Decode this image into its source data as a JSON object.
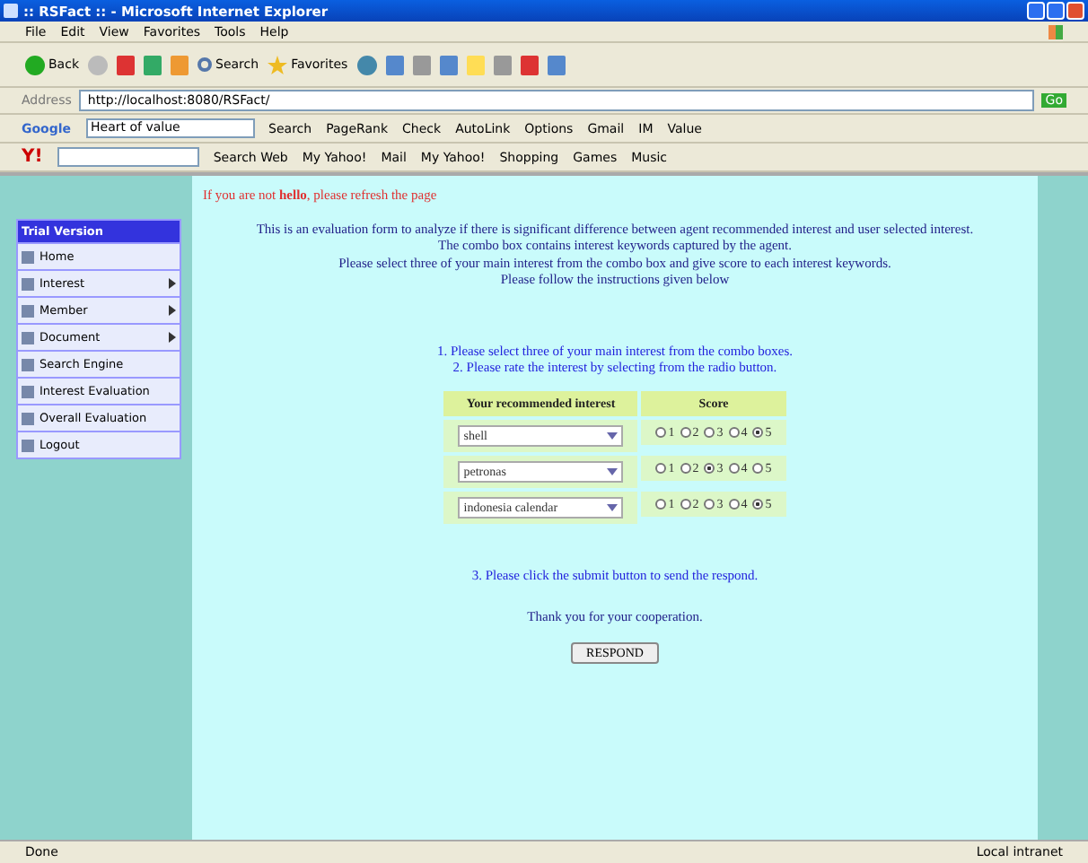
{
  "window": {
    "title": ":: RSFact :: - Microsoft Internet Explorer"
  },
  "menu": [
    "File",
    "Edit",
    "View",
    "Favorites",
    "Tools",
    "Help"
  ],
  "toolbar": {
    "back": "Back",
    "search": "Search",
    "favorites": "Favorites"
  },
  "address": {
    "label": "Address",
    "value": "http://localhost:8080/RSFact/",
    "go": "Go"
  },
  "google_toolbar": {
    "logo": "Google",
    "query": "Heart of value",
    "items": [
      "Search",
      "PageRank",
      "Check",
      "AutoLink",
      "Options",
      "Gmail",
      "IM",
      "Value"
    ]
  },
  "yahoo_toolbar": {
    "logo": "Y!",
    "items": [
      "Search Web",
      "My Yahoo!",
      "Mail",
      "My Yahoo!",
      "Shopping",
      "Games",
      "Music"
    ]
  },
  "sidebar": {
    "header": "Trial Version",
    "items": [
      {
        "label": "Home",
        "submenu": false
      },
      {
        "label": "Interest",
        "submenu": true
      },
      {
        "label": "Member",
        "submenu": true
      },
      {
        "label": "Document",
        "submenu": true
      },
      {
        "label": "Search Engine",
        "submenu": false
      },
      {
        "label": "Interest Evaluation",
        "submenu": false
      },
      {
        "label": "Overall Evaluation",
        "submenu": false
      },
      {
        "label": "Logout",
        "submenu": false
      }
    ]
  },
  "notice": "If you are not **hello**, please refresh the page",
  "intro": [
    "This is an evaluation form to analyze if there is significant difference between agent recommended interest and user selected interest.",
    "The combo box contains interest keywords captured by the agent.",
    "Please select three of your main interest from the combo box and give score to each interest keywords.",
    "Please follow the instructions given below"
  ],
  "steps": [
    "1. Please select three of your main interest from the combo boxes.",
    "2. Please rate the interest by selecting from the radio button."
  ],
  "table": {
    "columns": [
      "Your recommended interest",
      "Score"
    ],
    "rows": [
      {
        "interest": "shell",
        "scores": [
          {
            "label": "1",
            "selected": false
          },
          {
            "label": "2",
            "selected": false
          },
          {
            "label": "3",
            "selected": false
          },
          {
            "label": "4",
            "selected": false
          },
          {
            "label": "5",
            "selected": true
          }
        ]
      },
      {
        "interest": "petronas",
        "scores": [
          {
            "label": "1",
            "selected": false
          },
          {
            "label": "2",
            "selected": false
          },
          {
            "label": "3",
            "selected": true
          },
          {
            "label": "4",
            "selected": false
          },
          {
            "label": "5",
            "selected": false
          }
        ]
      },
      {
        "interest": "indonesia calendar",
        "scores": [
          {
            "label": "1",
            "selected": false
          },
          {
            "label": "2",
            "selected": false
          },
          {
            "label": "3",
            "selected": false
          },
          {
            "label": "4",
            "selected": false
          },
          {
            "label": "5",
            "selected": true
          }
        ]
      }
    ]
  },
  "step3": "3. Please click the submit button to send the respond.",
  "thanks": "Thank you for your cooperation.",
  "submit": "RESPOND",
  "status_bar": {
    "left": "Done",
    "right": "Local intranet"
  }
}
